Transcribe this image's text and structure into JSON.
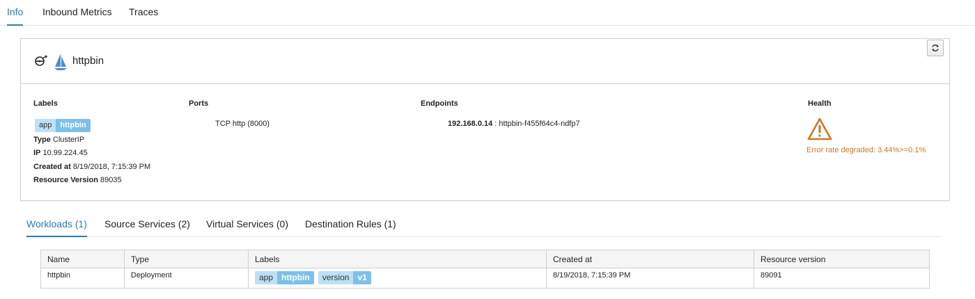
{
  "top_tabs": [
    {
      "label": "Info",
      "active": true
    },
    {
      "label": "Inbound Metrics",
      "active": false
    },
    {
      "label": "Traces",
      "active": false
    }
  ],
  "service": {
    "name": "httpbin",
    "icons": [
      "service-entry-icon",
      "istio-sail-icon",
      "refresh-icon"
    ]
  },
  "columns": {
    "labels_title": "Labels",
    "ports_title": "Ports",
    "endpoints_title": "Endpoints",
    "health_title": "Health"
  },
  "labels": [
    {
      "key": "app",
      "value": "httpbin"
    }
  ],
  "details": {
    "type_label": "Type",
    "type_value": "ClusterIP",
    "ip_label": "IP",
    "ip_value": "10.99.224.45",
    "created_label": "Created at",
    "created_value": "8/19/2018, 7:15:39 PM",
    "resource_label": "Resource Version",
    "resource_value": "89035"
  },
  "ports": [
    "TCP http (8000)"
  ],
  "endpoints": [
    {
      "ip": "192.168.0.14",
      "name": " : httpbin-f455f64c4-ndfp7"
    }
  ],
  "health": {
    "icon": "warning-triangle-icon",
    "text": "Error rate degraded: 3.44%>=0.1%",
    "color": "#c87828"
  },
  "sub_tabs": [
    {
      "label": "Workloads (1)",
      "active": true
    },
    {
      "label": "Source Services (2)",
      "active": false
    },
    {
      "label": "Virtual Services (0)",
      "active": false
    },
    {
      "label": "Destination Rules (1)",
      "active": false
    }
  ],
  "workloads_table": {
    "headers": [
      "Name",
      "Type",
      "Labels",
      "Created at",
      "Resource version"
    ],
    "rows": [
      {
        "name": "httpbin",
        "type": "Deployment",
        "labels": [
          {
            "key": "app",
            "value": "httpbin"
          },
          {
            "key": "version",
            "value": "v1"
          }
        ],
        "created_at": "8/19/2018, 7:15:39 PM",
        "resource_version": "89091"
      }
    ]
  },
  "colors": {
    "accent": "#2a7ab8",
    "chip_key": "#bde0f5",
    "chip_value": "#7cc0ea",
    "warning": "#c87828"
  }
}
